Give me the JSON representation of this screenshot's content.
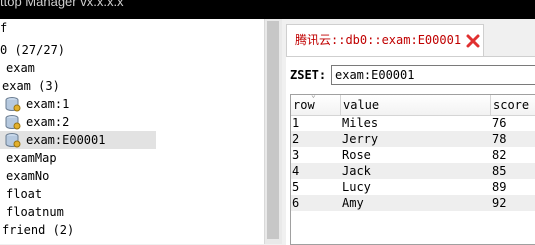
{
  "window": {
    "title": "ttop Manager vx.x.x.x"
  },
  "tree": {
    "items": [
      {
        "label": "f"
      },
      {
        "label": "0  (27/27)"
      },
      {
        "label": "exam"
      },
      {
        "label": "exam (3)"
      },
      {
        "label": "exam:1"
      },
      {
        "label": "exam:2"
      },
      {
        "label": "exam:E00001",
        "selected": true
      },
      {
        "label": "examMap"
      },
      {
        "label": "examNo"
      },
      {
        "label": "float"
      },
      {
        "label": "floatnum"
      },
      {
        "label": "friend (2)"
      }
    ]
  },
  "tab": {
    "label": "腾讯云::db0::exam:E00001",
    "close_icon": "close-icon"
  },
  "zset": {
    "label": "ZSET:",
    "key": "exam:E00001"
  },
  "table": {
    "headers": [
      "row",
      "value",
      "score"
    ],
    "rows": [
      {
        "row": "1",
        "value": "Miles",
        "score": "76"
      },
      {
        "row": "2",
        "value": "Jerry",
        "score": "78"
      },
      {
        "row": "3",
        "value": "Rose",
        "score": "82"
      },
      {
        "row": "4",
        "value": "Jack",
        "score": "85"
      },
      {
        "row": "5",
        "value": "Lucy",
        "score": "89"
      },
      {
        "row": "6",
        "value": "Amy",
        "score": "92"
      }
    ]
  },
  "colors": {
    "accent": "#c00000",
    "close": "#e03030",
    "selection": "#e2e2e2"
  }
}
